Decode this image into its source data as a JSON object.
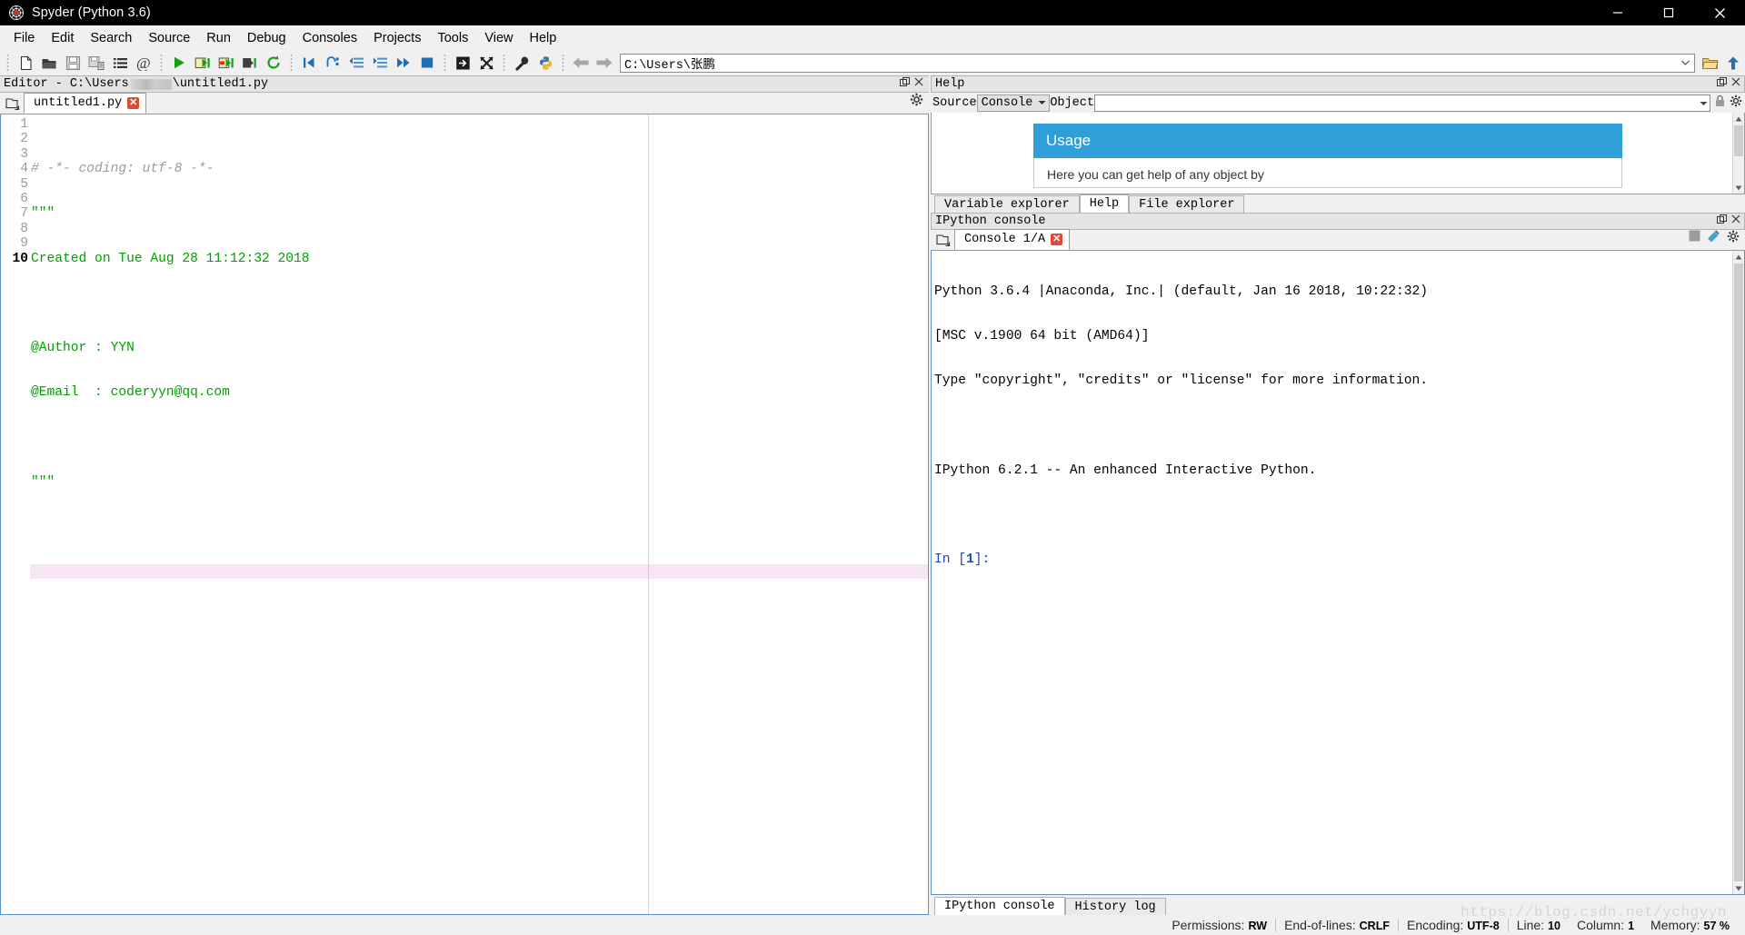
{
  "window": {
    "title": "Spyder (Python 3.6)",
    "app_icon": "spyder-web-icon",
    "minimize": "minimize-icon",
    "maximize": "maximize-icon",
    "close": "close-icon"
  },
  "menubar": {
    "items": [
      "File",
      "Edit",
      "Search",
      "Source",
      "Run",
      "Debug",
      "Consoles",
      "Projects",
      "Tools",
      "View",
      "Help"
    ]
  },
  "toolbar": {
    "groups": [
      [
        "new-file-icon",
        "open-file-icon",
        "save-file-icon",
        "save-all-icon",
        "list-icon",
        "at-icon"
      ],
      [
        "run-file-icon",
        "run-cell-icon",
        "run-cell-advance-icon",
        "run-selection-icon",
        "rerun-icon"
      ],
      [
        "debug-file-icon",
        "debug-step-icon",
        "debug-step-into-icon",
        "debug-step-return-icon",
        "debug-continue-icon",
        "debug-stop-icon"
      ],
      [
        "maximize-pane-icon",
        "fullscreen-pane-icon"
      ],
      [
        "preferences-icon",
        "pythonpath-manager-icon"
      ],
      [
        "back-icon",
        "forward-icon"
      ]
    ],
    "path_value": "C:\\Users\\张鹏",
    "open-dir-icon": "open-directory-icon",
    "parent-dir-icon": "parent-directory-icon"
  },
  "editor": {
    "pane_title_prefix": "Editor - C:\\Users",
    "pane_title_suffix": "\\untitled1.py",
    "pane_float_icon": "undock-icon",
    "pane_close_icon": "close-icon",
    "browse_tabs_icon": "browse-tabs-icon",
    "options_icon": "options-gear-icon",
    "tab": {
      "label": "untitled1.py",
      "close": "✕"
    },
    "lines": [
      {
        "n": "1",
        "text": "# -*- coding: utf-8 -*-",
        "cls": "c-comment",
        "highlight": false
      },
      {
        "n": "2",
        "text": "\"\"\"",
        "cls": "c-string",
        "highlight": false
      },
      {
        "n": "3",
        "text": "Created on Tue Aug 28 11:12:32 2018",
        "cls": "c-string",
        "highlight": false
      },
      {
        "n": "4",
        "text": "",
        "cls": "c-string",
        "highlight": false
      },
      {
        "n": "5",
        "text": "@Author : YYN",
        "cls": "c-string",
        "highlight": false
      },
      {
        "n": "6",
        "text": "@Email  : coderyyn@qq.com",
        "cls": "c-string",
        "highlight": false
      },
      {
        "n": "7",
        "text": "",
        "cls": "c-string",
        "highlight": false
      },
      {
        "n": "8",
        "text": "\"\"\"",
        "cls": "c-string",
        "highlight": false
      },
      {
        "n": "9",
        "text": "",
        "cls": "",
        "highlight": false
      },
      {
        "n": "10",
        "text": "",
        "cls": "",
        "highlight": true
      }
    ]
  },
  "help": {
    "pane_title": "Help",
    "source_label": "Source",
    "source_value": "Console",
    "object_label": "Object",
    "object_value": "",
    "lock_icon": "lock-icon",
    "options_icon": "options-gear-icon",
    "usage_title": "Usage",
    "usage_text": "Here you can get help of any object by",
    "pane_float_icon": "undock-icon",
    "pane_close_icon": "close-icon"
  },
  "panel_tabs": {
    "items": [
      {
        "label": "Variable explorer",
        "active": false
      },
      {
        "label": "Help",
        "active": true
      },
      {
        "label": "File explorer",
        "active": false
      }
    ]
  },
  "console": {
    "pane_title": "IPython console",
    "pane_float_icon": "undock-icon",
    "pane_close_icon": "close-icon",
    "browse_tabs_icon": "browse-tabs-icon",
    "tab": {
      "label": "Console 1/A",
      "close": "✕"
    },
    "stop_icon": "stop-icon",
    "env_icon": "environment-icon",
    "options_icon": "options-gear-icon",
    "output": [
      "Python 3.6.4 |Anaconda, Inc.| (default, Jan 16 2018, 10:22:32)",
      "[MSC v.1900 64 bit (AMD64)]",
      "Type \"copyright\", \"credits\" or \"license\" for more information.",
      ""
    ],
    "output2": "IPython 6.2.1 -- An enhanced Interactive Python.",
    "prompt_prefix": "In [",
    "prompt_number": "1",
    "prompt_suffix": "]:"
  },
  "bottom_tabs": {
    "items": [
      {
        "label": "IPython console",
        "active": true
      },
      {
        "label": "History log",
        "active": false
      }
    ]
  },
  "statusbar": {
    "items": [
      {
        "label": "Permissions:",
        "value": "RW"
      },
      {
        "label": "End-of-lines:",
        "value": "CRLF"
      },
      {
        "label": "Encoding:",
        "value": "UTF-8"
      },
      {
        "label": "Line:",
        "value": "10"
      },
      {
        "label": "Column:",
        "value": "1"
      },
      {
        "label": "Memory:",
        "value": "57 %"
      }
    ]
  },
  "watermark": "https://blog.csdn.net/ychgyyn",
  "colors": {
    "accent_blue": "#2f9fda",
    "string_green": "#00a000",
    "comment_gray": "#9b9b9b",
    "prompt_blue": "#1c47b5",
    "highlight_line": "#f7e5f5",
    "close_red": "#e04a35"
  }
}
